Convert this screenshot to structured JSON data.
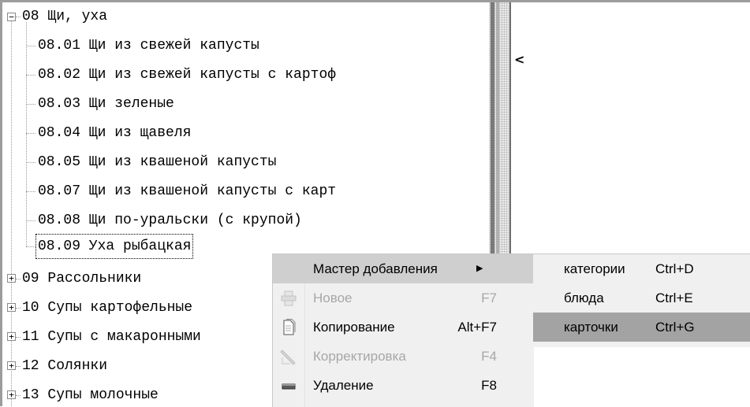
{
  "tree": {
    "items": [
      {
        "text": "08 Щи, уха",
        "level": 0,
        "expanded": true
      },
      {
        "text": "08.01 Щи из свежей капусты",
        "level": 1
      },
      {
        "text": "08.02 Щи из свежей капусты с картоф",
        "level": 1
      },
      {
        "text": "08.03 Щи зеленые",
        "level": 1
      },
      {
        "text": "08.04 Щи из щавеля",
        "level": 1
      },
      {
        "text": "08.05 Щи из квашеной капусты",
        "level": 1
      },
      {
        "text": "08.07 Щи из квашеной капусты с карт",
        "level": 1
      },
      {
        "text": "08.08 Щи по-уральски (с крупой)",
        "level": 1
      },
      {
        "text": "08.09 Уха рыбацкая",
        "level": 1,
        "selected": true
      },
      {
        "text": "09 Рассольники",
        "level": 0,
        "expanded": false
      },
      {
        "text": "10 Супы картофельные",
        "level": 0,
        "expanded": false
      },
      {
        "text": "11 Супы с макаронными",
        "level": 0,
        "expanded": false
      },
      {
        "text": "12 Солянки",
        "level": 0,
        "expanded": false
      },
      {
        "text": "13 Супы молочные",
        "level": 0,
        "expanded": false
      }
    ],
    "expand_glyph": "+",
    "collapse_glyph": "−"
  },
  "splitter": {
    "collapse_glyph": "<"
  },
  "context_menu": {
    "items": [
      {
        "label": "Мастер добавления",
        "shortcut": "",
        "submenu_glyph": "▶",
        "active": true,
        "enabled": true,
        "icon": ""
      },
      {
        "label": "Новое",
        "shortcut": "F7",
        "enabled": false,
        "icon": "new-doc-icon"
      },
      {
        "label": "Копирование",
        "shortcut": "Alt+F7",
        "enabled": true,
        "icon": "copy-doc-icon"
      },
      {
        "label": "Корректировка",
        "shortcut": "F4",
        "enabled": false,
        "icon": "edit-pencil-icon"
      },
      {
        "label": "Удаление",
        "shortcut": "F8",
        "enabled": true,
        "icon": "delete-icon"
      }
    ]
  },
  "submenu": {
    "items": [
      {
        "label": "категории",
        "shortcut": "Ctrl+D",
        "hover": false
      },
      {
        "label": "блюда",
        "shortcut": "Ctrl+E",
        "hover": false
      },
      {
        "label": "карточки",
        "shortcut": "Ctrl+G",
        "hover": true
      }
    ]
  },
  "colors": {
    "menu_bg": "#f0f0f0",
    "hover": "#a3a3a3",
    "active": "#cfcfcf",
    "disabled_text": "#a7a7a7"
  }
}
